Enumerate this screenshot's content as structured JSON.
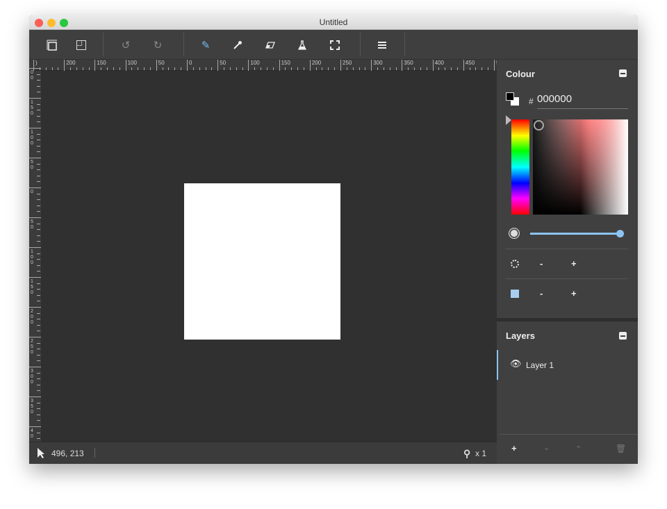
{
  "window": {
    "title": "Untitled"
  },
  "toolbar": {
    "icons": [
      "layers-stack-icon",
      "crop-icon",
      "undo-icon",
      "redo-icon",
      "pencil-icon",
      "eyedropper-icon",
      "eraser-icon",
      "flask-icon",
      "fullscreen-icon",
      "menu-icon"
    ],
    "accent": "#7ab8f0"
  },
  "rulers": {
    "top": [
      ")",
      "200",
      "150",
      "100",
      "50",
      "0",
      "50",
      "100",
      "150",
      "200",
      "250",
      "300",
      "350",
      "400",
      "450",
      "5"
    ],
    "left": [
      "00",
      "150",
      "100",
      "50",
      "0",
      "50",
      "100",
      "150",
      "200",
      "250",
      "300",
      "350",
      "40"
    ]
  },
  "status": {
    "coords": "496, 213",
    "zoom": "x 1"
  },
  "colour": {
    "title": "Colour",
    "hash": "#",
    "hex": "000000",
    "opacity_percent": 100,
    "brush_minus": "-",
    "brush_plus": "+",
    "shape_minus": "-",
    "shape_plus": "+"
  },
  "layers": {
    "title": "Layers",
    "items": [
      {
        "name": "Layer 1"
      }
    ],
    "add": "+"
  }
}
